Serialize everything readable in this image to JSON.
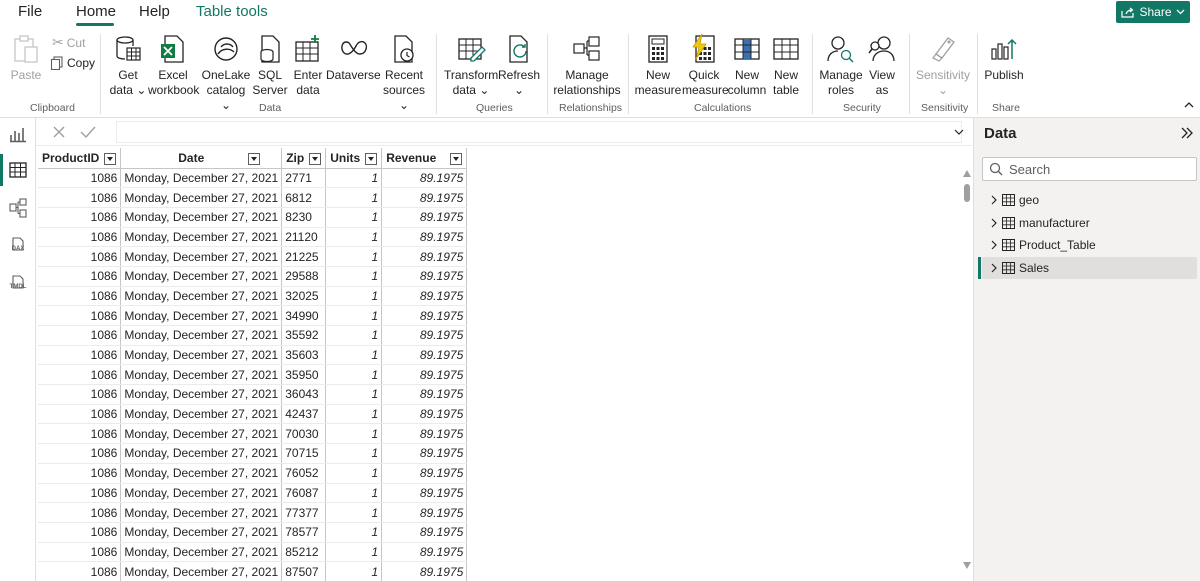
{
  "menu": {
    "file": "File",
    "home": "Home",
    "help": "Help",
    "table_tools": "Table tools",
    "share": "Share"
  },
  "ribbon": {
    "clipboard": {
      "paste": "Paste",
      "cut": "Cut",
      "copy": "Copy",
      "label": "Clipboard"
    },
    "data": {
      "get_data_1": "Get",
      "get_data_2": "data",
      "excel_1": "Excel",
      "excel_2": "workbook",
      "onelake_1": "OneLake",
      "onelake_2": "catalog",
      "sql_1": "SQL",
      "sql_2": "Server",
      "enter_1": "Enter",
      "enter_2": "data",
      "dataverse": "Dataverse",
      "recent_1": "Recent",
      "recent_2": "sources",
      "label": "Data"
    },
    "queries": {
      "transform_1": "Transform",
      "transform_2": "data",
      "refresh": "Refresh",
      "label": "Queries"
    },
    "relationships": {
      "manage_1": "Manage",
      "manage_2": "relationships",
      "label": "Relationships"
    },
    "calculations": {
      "new_measure_1": "New",
      "new_measure_2": "measure",
      "quick_1": "Quick",
      "quick_2": "measure",
      "new_column_1": "New",
      "new_column_2": "column",
      "new_table_1": "New",
      "new_table_2": "table",
      "label": "Calculations"
    },
    "security": {
      "manage_roles_1": "Manage",
      "manage_roles_2": "roles",
      "view_as_1": "View",
      "view_as_2": "as",
      "label": "Security"
    },
    "sensitivity": {
      "button": "Sensitivity",
      "label": "Sensitivity"
    },
    "share": {
      "publish": "Publish",
      "label": "Share"
    }
  },
  "leftnav": {
    "dax": "DAX",
    "tmdl": "TMDL"
  },
  "table": {
    "columns": [
      "ProductID",
      "Date",
      "Zip",
      "Units",
      "Revenue"
    ],
    "rows": [
      [
        "1086",
        "Monday, December 27, 2021",
        "2771",
        "1",
        "89.1975"
      ],
      [
        "1086",
        "Monday, December 27, 2021",
        "6812",
        "1",
        "89.1975"
      ],
      [
        "1086",
        "Monday, December 27, 2021",
        "8230",
        "1",
        "89.1975"
      ],
      [
        "1086",
        "Monday, December 27, 2021",
        "21120",
        "1",
        "89.1975"
      ],
      [
        "1086",
        "Monday, December 27, 2021",
        "21225",
        "1",
        "89.1975"
      ],
      [
        "1086",
        "Monday, December 27, 2021",
        "29588",
        "1",
        "89.1975"
      ],
      [
        "1086",
        "Monday, December 27, 2021",
        "32025",
        "1",
        "89.1975"
      ],
      [
        "1086",
        "Monday, December 27, 2021",
        "34990",
        "1",
        "89.1975"
      ],
      [
        "1086",
        "Monday, December 27, 2021",
        "35592",
        "1",
        "89.1975"
      ],
      [
        "1086",
        "Monday, December 27, 2021",
        "35603",
        "1",
        "89.1975"
      ],
      [
        "1086",
        "Monday, December 27, 2021",
        "35950",
        "1",
        "89.1975"
      ],
      [
        "1086",
        "Monday, December 27, 2021",
        "36043",
        "1",
        "89.1975"
      ],
      [
        "1086",
        "Monday, December 27, 2021",
        "42437",
        "1",
        "89.1975"
      ],
      [
        "1086",
        "Monday, December 27, 2021",
        "70030",
        "1",
        "89.1975"
      ],
      [
        "1086",
        "Monday, December 27, 2021",
        "70715",
        "1",
        "89.1975"
      ],
      [
        "1086",
        "Monday, December 27, 2021",
        "76052",
        "1",
        "89.1975"
      ],
      [
        "1086",
        "Monday, December 27, 2021",
        "76087",
        "1",
        "89.1975"
      ],
      [
        "1086",
        "Monday, December 27, 2021",
        "77377",
        "1",
        "89.1975"
      ],
      [
        "1086",
        "Monday, December 27, 2021",
        "78577",
        "1",
        "89.1975"
      ],
      [
        "1086",
        "Monday, December 27, 2021",
        "85212",
        "1",
        "89.1975"
      ],
      [
        "1086",
        "Monday, December 27, 2021",
        "87507",
        "1",
        "89.1975"
      ]
    ]
  },
  "datapane": {
    "title": "Data",
    "search_placeholder": "Search",
    "items": [
      "geo",
      "manufacturer",
      "Product_Table",
      "Sales"
    ],
    "selected": "Sales"
  },
  "colors": {
    "accent": "#117865",
    "border": "#c8c6c4",
    "pane_bg": "#f3f2f1"
  }
}
